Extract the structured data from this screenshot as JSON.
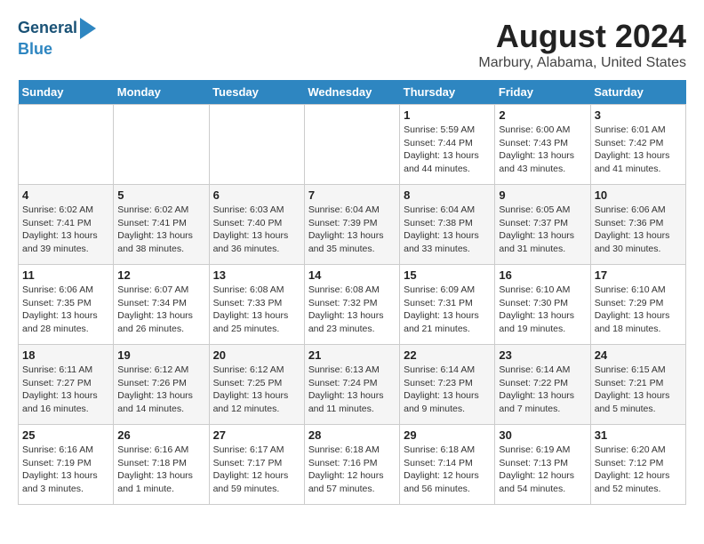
{
  "header": {
    "logo_line1": "General",
    "logo_line2": "Blue",
    "title": "August 2024",
    "subtitle": "Marbury, Alabama, United States"
  },
  "days_of_week": [
    "Sunday",
    "Monday",
    "Tuesday",
    "Wednesday",
    "Thursday",
    "Friday",
    "Saturday"
  ],
  "weeks": [
    [
      {
        "day": "",
        "info": ""
      },
      {
        "day": "",
        "info": ""
      },
      {
        "day": "",
        "info": ""
      },
      {
        "day": "",
        "info": ""
      },
      {
        "day": "1",
        "info": "Sunrise: 5:59 AM\nSunset: 7:44 PM\nDaylight: 13 hours\nand 44 minutes."
      },
      {
        "day": "2",
        "info": "Sunrise: 6:00 AM\nSunset: 7:43 PM\nDaylight: 13 hours\nand 43 minutes."
      },
      {
        "day": "3",
        "info": "Sunrise: 6:01 AM\nSunset: 7:42 PM\nDaylight: 13 hours\nand 41 minutes."
      }
    ],
    [
      {
        "day": "4",
        "info": "Sunrise: 6:02 AM\nSunset: 7:41 PM\nDaylight: 13 hours\nand 39 minutes."
      },
      {
        "day": "5",
        "info": "Sunrise: 6:02 AM\nSunset: 7:41 PM\nDaylight: 13 hours\nand 38 minutes."
      },
      {
        "day": "6",
        "info": "Sunrise: 6:03 AM\nSunset: 7:40 PM\nDaylight: 13 hours\nand 36 minutes."
      },
      {
        "day": "7",
        "info": "Sunrise: 6:04 AM\nSunset: 7:39 PM\nDaylight: 13 hours\nand 35 minutes."
      },
      {
        "day": "8",
        "info": "Sunrise: 6:04 AM\nSunset: 7:38 PM\nDaylight: 13 hours\nand 33 minutes."
      },
      {
        "day": "9",
        "info": "Sunrise: 6:05 AM\nSunset: 7:37 PM\nDaylight: 13 hours\nand 31 minutes."
      },
      {
        "day": "10",
        "info": "Sunrise: 6:06 AM\nSunset: 7:36 PM\nDaylight: 13 hours\nand 30 minutes."
      }
    ],
    [
      {
        "day": "11",
        "info": "Sunrise: 6:06 AM\nSunset: 7:35 PM\nDaylight: 13 hours\nand 28 minutes."
      },
      {
        "day": "12",
        "info": "Sunrise: 6:07 AM\nSunset: 7:34 PM\nDaylight: 13 hours\nand 26 minutes."
      },
      {
        "day": "13",
        "info": "Sunrise: 6:08 AM\nSunset: 7:33 PM\nDaylight: 13 hours\nand 25 minutes."
      },
      {
        "day": "14",
        "info": "Sunrise: 6:08 AM\nSunset: 7:32 PM\nDaylight: 13 hours\nand 23 minutes."
      },
      {
        "day": "15",
        "info": "Sunrise: 6:09 AM\nSunset: 7:31 PM\nDaylight: 13 hours\nand 21 minutes."
      },
      {
        "day": "16",
        "info": "Sunrise: 6:10 AM\nSunset: 7:30 PM\nDaylight: 13 hours\nand 19 minutes."
      },
      {
        "day": "17",
        "info": "Sunrise: 6:10 AM\nSunset: 7:29 PM\nDaylight: 13 hours\nand 18 minutes."
      }
    ],
    [
      {
        "day": "18",
        "info": "Sunrise: 6:11 AM\nSunset: 7:27 PM\nDaylight: 13 hours\nand 16 minutes."
      },
      {
        "day": "19",
        "info": "Sunrise: 6:12 AM\nSunset: 7:26 PM\nDaylight: 13 hours\nand 14 minutes."
      },
      {
        "day": "20",
        "info": "Sunrise: 6:12 AM\nSunset: 7:25 PM\nDaylight: 13 hours\nand 12 minutes."
      },
      {
        "day": "21",
        "info": "Sunrise: 6:13 AM\nSunset: 7:24 PM\nDaylight: 13 hours\nand 11 minutes."
      },
      {
        "day": "22",
        "info": "Sunrise: 6:14 AM\nSunset: 7:23 PM\nDaylight: 13 hours\nand 9 minutes."
      },
      {
        "day": "23",
        "info": "Sunrise: 6:14 AM\nSunset: 7:22 PM\nDaylight: 13 hours\nand 7 minutes."
      },
      {
        "day": "24",
        "info": "Sunrise: 6:15 AM\nSunset: 7:21 PM\nDaylight: 13 hours\nand 5 minutes."
      }
    ],
    [
      {
        "day": "25",
        "info": "Sunrise: 6:16 AM\nSunset: 7:19 PM\nDaylight: 13 hours\nand 3 minutes."
      },
      {
        "day": "26",
        "info": "Sunrise: 6:16 AM\nSunset: 7:18 PM\nDaylight: 13 hours\nand 1 minute."
      },
      {
        "day": "27",
        "info": "Sunrise: 6:17 AM\nSunset: 7:17 PM\nDaylight: 12 hours\nand 59 minutes."
      },
      {
        "day": "28",
        "info": "Sunrise: 6:18 AM\nSunset: 7:16 PM\nDaylight: 12 hours\nand 57 minutes."
      },
      {
        "day": "29",
        "info": "Sunrise: 6:18 AM\nSunset: 7:14 PM\nDaylight: 12 hours\nand 56 minutes."
      },
      {
        "day": "30",
        "info": "Sunrise: 6:19 AM\nSunset: 7:13 PM\nDaylight: 12 hours\nand 54 minutes."
      },
      {
        "day": "31",
        "info": "Sunrise: 6:20 AM\nSunset: 7:12 PM\nDaylight: 12 hours\nand 52 minutes."
      }
    ]
  ]
}
